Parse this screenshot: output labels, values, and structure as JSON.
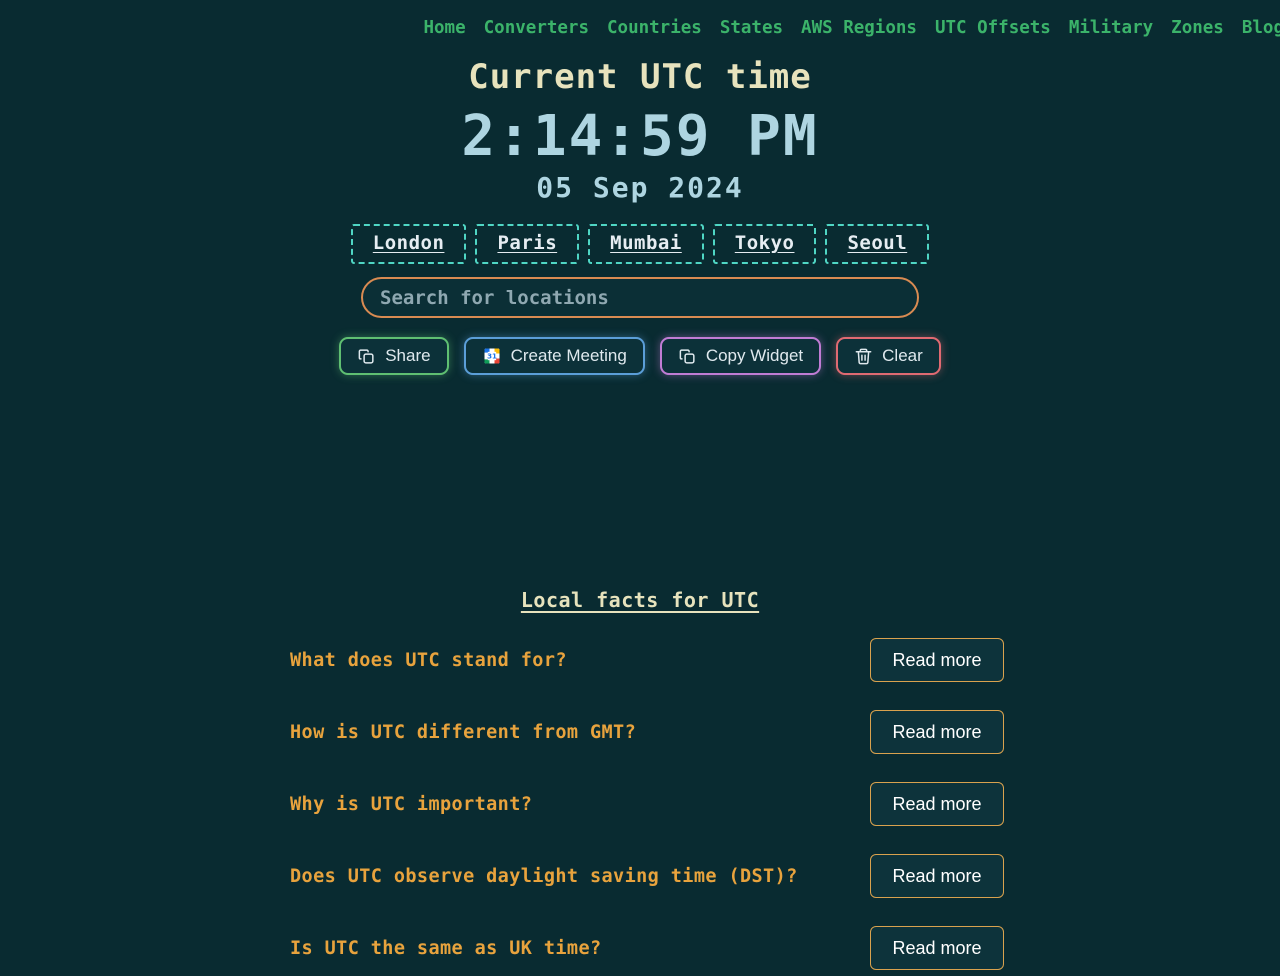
{
  "nav": {
    "items": [
      {
        "label": "Home"
      },
      {
        "label": "Converters"
      },
      {
        "label": "Countries"
      },
      {
        "label": "States"
      },
      {
        "label": "AWS Regions"
      },
      {
        "label": "UTC Offsets"
      },
      {
        "label": "Military"
      },
      {
        "label": "Zones"
      },
      {
        "label": "Blog"
      }
    ]
  },
  "hero": {
    "title": "Current UTC time",
    "time": "2:14:59 PM",
    "date": "05 Sep 2024"
  },
  "cities": [
    {
      "label": "London"
    },
    {
      "label": "Paris"
    },
    {
      "label": "Mumbai"
    },
    {
      "label": "Tokyo"
    },
    {
      "label": "Seoul"
    }
  ],
  "search": {
    "placeholder": "Search for locations",
    "value": ""
  },
  "actions": [
    {
      "label": "Share",
      "icon": "copy-icon",
      "color": "#5fbf72"
    },
    {
      "label": "Create Meeting",
      "icon": "google-calendar-icon",
      "color": "#5b9ed8"
    },
    {
      "label": "Copy Widget",
      "icon": "copy-icon",
      "color": "#c07cd4"
    },
    {
      "label": "Clear",
      "icon": "trash-icon",
      "color": "#e06a72"
    }
  ],
  "facts": {
    "heading": "Local facts for UTC",
    "read_more_label": "Read more",
    "items": [
      {
        "question": "What does UTC stand for?"
      },
      {
        "question": "How is UTC different from GMT?"
      },
      {
        "question": "Why is UTC important?"
      },
      {
        "question": "Does UTC observe daylight saving time (DST)?"
      },
      {
        "question": "Is UTC the same as UK time?"
      }
    ]
  },
  "theme": {
    "background": "#092b31",
    "nav_green": "#3bb36a",
    "title_cream": "#e7e3bd",
    "time_blue": "#aed5e1",
    "chip_teal": "#4fd6c4",
    "search_orange": "#d98b52",
    "question_orange": "#e8a33d",
    "readmore_gold": "#d9a24e"
  }
}
